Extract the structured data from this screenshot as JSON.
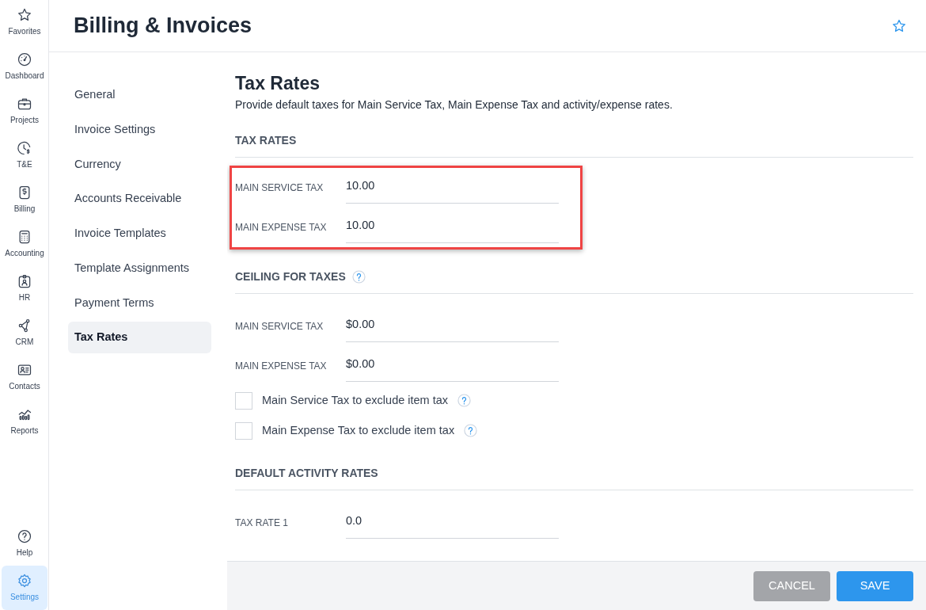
{
  "rail": {
    "items": [
      {
        "label": "Favorites",
        "selected": false
      },
      {
        "label": "Dashboard",
        "selected": false
      },
      {
        "label": "Projects",
        "selected": false
      },
      {
        "label": "T&E",
        "selected": false
      },
      {
        "label": "Billing",
        "selected": false
      },
      {
        "label": "Accounting",
        "selected": false
      },
      {
        "label": "HR",
        "selected": false
      },
      {
        "label": "CRM",
        "selected": false
      },
      {
        "label": "Contacts",
        "selected": false
      },
      {
        "label": "Reports",
        "selected": false
      }
    ],
    "bottom_items": [
      {
        "label": "Help",
        "selected": false
      },
      {
        "label": "Settings",
        "selected": true
      }
    ]
  },
  "header": {
    "title": "Billing & Invoices",
    "favorite": false
  },
  "subnav": [
    {
      "label": "General",
      "selected": false
    },
    {
      "label": "Invoice Settings",
      "selected": false
    },
    {
      "label": "Currency",
      "selected": false
    },
    {
      "label": "Accounts Receivable",
      "selected": false
    },
    {
      "label": "Invoice Templates",
      "selected": false
    },
    {
      "label": "Template Assignments",
      "selected": false
    },
    {
      "label": "Payment Terms",
      "selected": false
    },
    {
      "label": "Tax Rates",
      "selected": true
    }
  ],
  "content": {
    "title": "Tax Rates",
    "description": "Provide default taxes for Main Service Tax, Main Expense Tax and activity/expense rates.",
    "sections": [
      {
        "heading": "TAX RATES",
        "help": false,
        "highlighted": true,
        "fields": [
          {
            "label": "MAIN SERVICE TAX",
            "value": "10.00"
          },
          {
            "label": "MAIN EXPENSE TAX",
            "value": "10.00"
          }
        ]
      },
      {
        "heading": "CEILING FOR TAXES",
        "help": true,
        "highlighted": false,
        "fields": [
          {
            "label": "MAIN SERVICE TAX",
            "value": "$0.00"
          },
          {
            "label": "MAIN EXPENSE TAX",
            "value": "$0.00"
          }
        ],
        "checkboxes": [
          {
            "label": "Main Service Tax to exclude item tax",
            "checked": false,
            "help": true
          },
          {
            "label": "Main Expense Tax to exclude item tax",
            "checked": false,
            "help": true
          }
        ]
      },
      {
        "heading": "DEFAULT ACTIVITY RATES",
        "help": false,
        "highlighted": false,
        "fields": [
          {
            "label": "TAX RATE 1",
            "value": "0.0"
          }
        ]
      }
    ]
  },
  "footer": {
    "buttons": [
      {
        "label": "CANCEL",
        "kind": "secondary"
      },
      {
        "label": "SAVE",
        "kind": "primary"
      }
    ]
  }
}
